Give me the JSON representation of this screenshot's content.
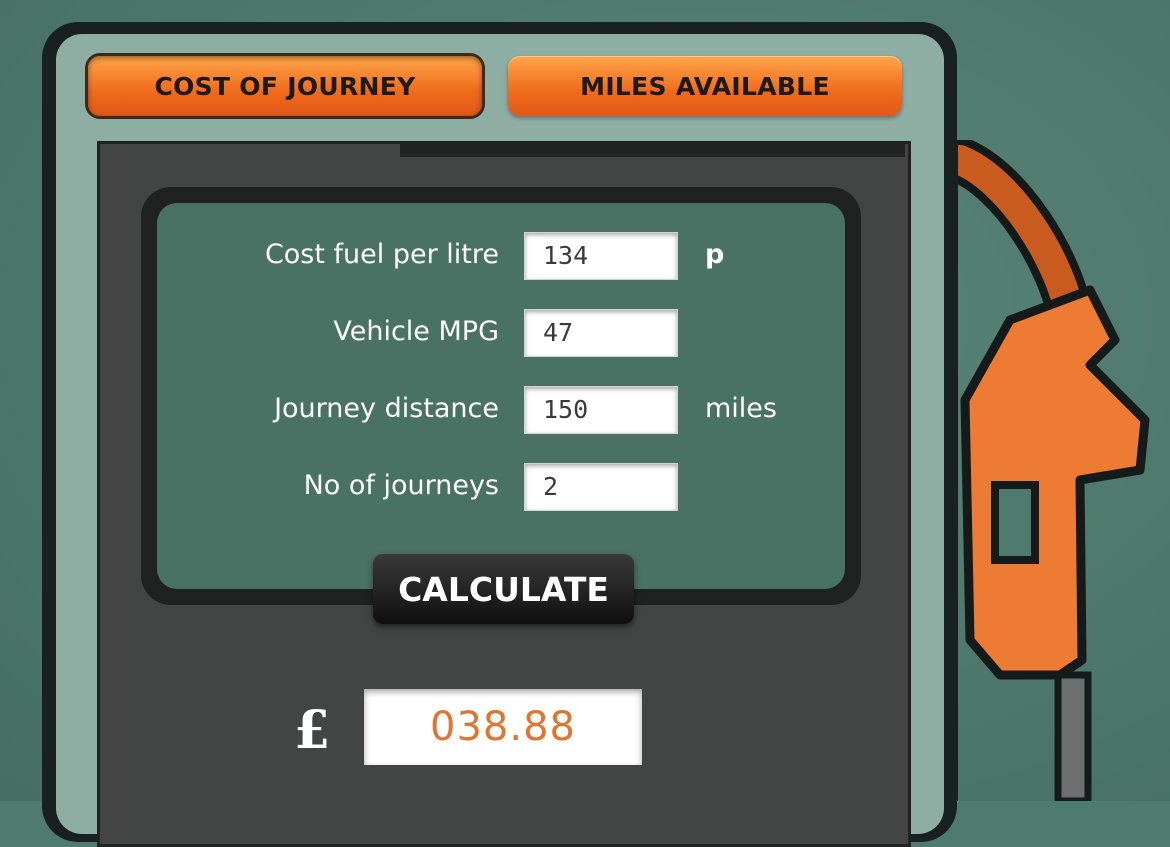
{
  "tabs": {
    "cost_of_journey": "COST OF JOURNEY",
    "miles_available": "MILES AVAILABLE"
  },
  "form": {
    "rows": [
      {
        "label": "Cost fuel per litre",
        "value": "134",
        "unit": "p"
      },
      {
        "label": "Vehicle MPG",
        "value": "47",
        "unit": ""
      },
      {
        "label": "Journey distance",
        "value": "150",
        "unit": "miles"
      },
      {
        "label": "No of journeys",
        "value": "2",
        "unit": ""
      }
    ]
  },
  "calculate_label": "CALCULATE",
  "result": {
    "currency": "£",
    "value": "038.88"
  },
  "colors": {
    "accent": "#f06a1b",
    "result_text": "#e37430",
    "panel": "#497164",
    "background": "#4f7a6e"
  },
  "icons": {
    "nozzle": "fuel-nozzle-icon"
  }
}
